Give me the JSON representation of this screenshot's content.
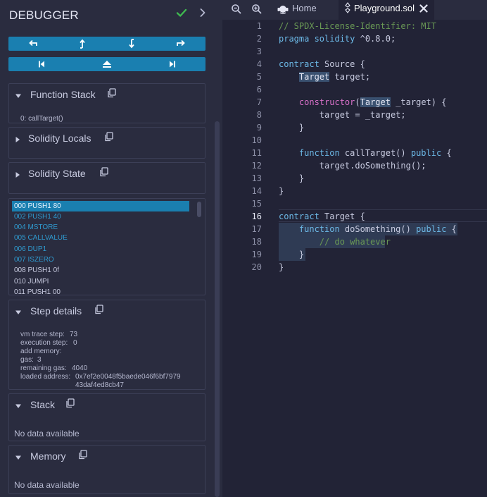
{
  "debugger": {
    "title": "DEBUGGER",
    "function_stack": {
      "title": "Function Stack",
      "items": [
        "0: callTarget()"
      ]
    },
    "solidity_locals": {
      "title": "Solidity Locals"
    },
    "solidity_state": {
      "title": "Solidity State"
    },
    "opcodes": [
      "000 PUSH1 80",
      "002 PUSH1 40",
      "004 MSTORE",
      "005 CALLVALUE",
      "006 DUP1",
      "007 ISZERO",
      "008 PUSH1 0f",
      "010 JUMPI",
      "011 PUSH1 00"
    ],
    "step_details": {
      "title": "Step details",
      "vm_trace_step_label": "vm trace step:",
      "vm_trace_step": "73",
      "execution_step_label": "execution step:",
      "execution_step": "0",
      "add_memory_label": "add memory:",
      "add_memory": "",
      "gas_label": "gas:",
      "gas": "3",
      "remaining_gas_label": "remaining gas:",
      "remaining_gas": "4040",
      "loaded_address_label": "loaded address:",
      "loaded_address_line1": "0x7ef2e0048f5baede046f6bf7979",
      "loaded_address_line2": "43daf4ed8cb47"
    },
    "stack": {
      "title": "Stack",
      "empty": "No data available"
    },
    "memory": {
      "title": "Memory",
      "empty": "No data available"
    }
  },
  "editor": {
    "tabs": [
      {
        "label": "Home"
      },
      {
        "label": "Playground.sol"
      }
    ],
    "active_tab": "Playground.sol",
    "current_line": 16,
    "line_numbers": [
      "1",
      "2",
      "3",
      "4",
      "5",
      "6",
      "7",
      "8",
      "9",
      "10",
      "11",
      "12",
      "13",
      "14",
      "15",
      "16",
      "17",
      "18",
      "19",
      "20"
    ],
    "code": {
      "l1": "// SPDX-License-Identifier: MIT",
      "l2a": "pragma solidity",
      "l2b": " ^0.8.0;",
      "l4a": "contract",
      "l4b": " Source {",
      "l5a": "Target",
      "l5b": " target;",
      "l7a": "constructor",
      "l7b": "(",
      "l7c": "Target",
      "l7d": " _target) {",
      "l8": "target = _target;",
      "l9": "}",
      "l11a": "function",
      "l11b": " callTarget() ",
      "l11c": "public",
      "l11d": " {",
      "l12": "target.doSomething();",
      "l13": "}",
      "l14": "}",
      "l16a": "contract",
      "l16b": " Target {",
      "l17a": "function",
      "l17b": " doSomething() ",
      "l17c": "public",
      "l17d": " {",
      "l18": "// do whatever",
      "l19": "}",
      "l20": "}"
    }
  },
  "colors": {
    "accent": "#1a7fb0",
    "panel_bg": "#2a2c3f",
    "editor_bg": "#222336",
    "check": "#3fb950"
  }
}
